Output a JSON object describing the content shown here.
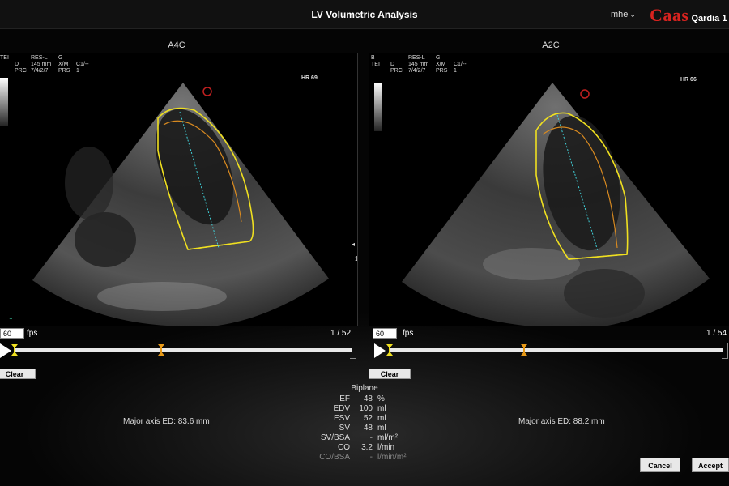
{
  "app": {
    "title": "LV Volumetric Analysis",
    "user": "mhe",
    "brand": "Caas",
    "product": "Qardia 1"
  },
  "views": [
    {
      "label": "A4C",
      "meta_col1": "TEI",
      "meta_col2": "D\nPRC",
      "meta_col3": "RES-L\n145 mm\n7/4/2/7",
      "meta_col4": "G\nX/M\nPRS",
      "meta_col5": "C1/--\n1",
      "hr": "HR 69",
      "fps_value": "60",
      "fps_label": "fps",
      "frame": "1 / 52",
      "clear_label": "Clear",
      "major_axis": "Major axis ED: 83.6 mm"
    },
    {
      "label": "A2C",
      "meta_col1": "B\nTEI",
      "meta_col2": "D\nPRC",
      "meta_col3": "RES-L\n145 mm\n7/4/2/7",
      "meta_col4": "G\nX/M\nPRS",
      "meta_col5": "—\nC1/--\n1",
      "hr": "HR 66",
      "fps_value": "60",
      "fps_label": "fps",
      "frame": "1 / 54",
      "clear_label": "Clear",
      "major_axis": "Major axis ED: 88.2 mm"
    }
  ],
  "results": {
    "title": "Biplane",
    "rows": [
      {
        "label": "EF",
        "value": "48",
        "unit": "%"
      },
      {
        "label": "EDV",
        "value": "100",
        "unit": "ml"
      },
      {
        "label": "ESV",
        "value": "52",
        "unit": "ml"
      },
      {
        "label": "SV",
        "value": "48",
        "unit": "ml"
      },
      {
        "label": "SV/BSA",
        "value": "-",
        "unit": "ml/m²"
      },
      {
        "label": "CO",
        "value": "3.2",
        "unit": "l/min"
      },
      {
        "label": "CO/BSA",
        "value": "-",
        "unit": "l/min/m²"
      }
    ]
  },
  "actions": {
    "cancel": "Cancel",
    "accept": "Accept"
  },
  "colors": {
    "brand_red": "#d8231f",
    "contour_yellow": "#f0e020",
    "axis_cyan": "#40d0d8",
    "marker_orange": "#e89a18"
  }
}
